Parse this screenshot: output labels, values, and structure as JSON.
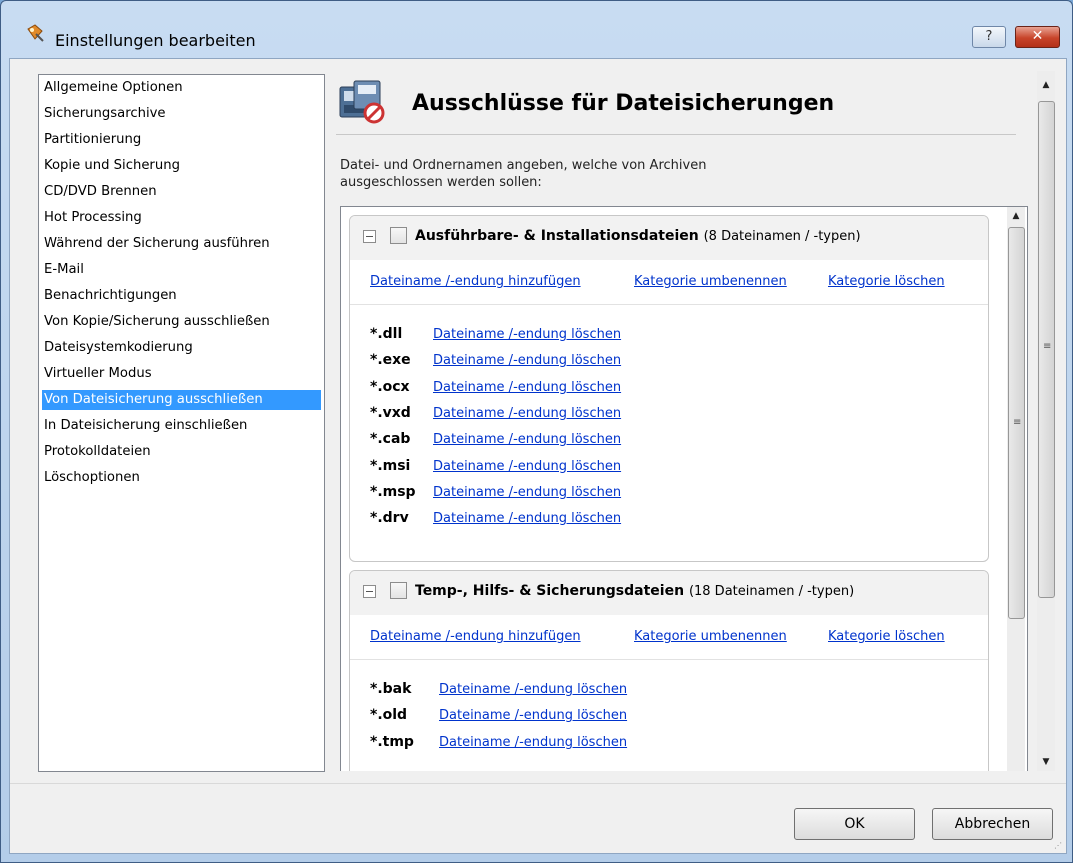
{
  "window": {
    "title": "Einstellungen bearbeiten",
    "help_label": "?",
    "close_label": "✕"
  },
  "nav": {
    "items": [
      "Allgemeine Optionen",
      "Sicherungsarchive",
      "Partitionierung",
      "Kopie und Sicherung",
      "CD/DVD Brennen",
      "Hot Processing",
      "Während der Sicherung ausführen",
      "E-Mail",
      "Benachrichtigungen",
      "Von Kopie/Sicherung ausschließen",
      "Dateisystemkodierung",
      "Virtueller Modus",
      "Von Dateisicherung ausschließen",
      "In Dateisicherung einschließen",
      "Protokolldateien",
      "Löschoptionen"
    ],
    "selected_index": 12
  },
  "content": {
    "title": "Ausschlüsse für Dateisicherungen",
    "description_line1": "Datei- und Ordnernamen angeben, welche von Archiven",
    "description_line2": "ausgeschlossen werden sollen:"
  },
  "categories": [
    {
      "title": "Ausführbare- & Installationsdateien",
      "count": "(8 Dateinamen / -typen)",
      "add_link": "Dateiname /-endung hinzufügen",
      "rename_link": "Kategorie umbenennen",
      "delete_link": "Kategorie löschen",
      "entries": [
        {
          "ext": "*.dll",
          "link": "Dateiname /-endung löschen"
        },
        {
          "ext": "*.exe",
          "link": "Dateiname /-endung löschen"
        },
        {
          "ext": "*.ocx",
          "link": "Dateiname /-endung löschen"
        },
        {
          "ext": "*.vxd",
          "link": "Dateiname /-endung löschen"
        },
        {
          "ext": "*.cab",
          "link": "Dateiname /-endung löschen"
        },
        {
          "ext": "*.msi",
          "link": "Dateiname /-endung löschen"
        },
        {
          "ext": "*.msp",
          "link": "Dateiname /-endung löschen"
        },
        {
          "ext": "*.drv",
          "link": "Dateiname /-endung löschen"
        }
      ]
    },
    {
      "title": "Temp-, Hilfs- & Sicherungsdateien",
      "count": "(18 Dateinamen / -typen)",
      "add_link": "Dateiname /-endung hinzufügen",
      "rename_link": "Kategorie umbenennen",
      "delete_link": "Kategorie löschen",
      "entries": [
        {
          "ext": "*.bak",
          "link": "Dateiname /-endung löschen"
        },
        {
          "ext": "*.old",
          "link": "Dateiname /-endung löschen"
        },
        {
          "ext": "*.tmp",
          "link": "Dateiname /-endung löschen"
        }
      ]
    }
  ],
  "buttons": {
    "ok": "OK",
    "cancel": "Abbrechen"
  },
  "colors": {
    "selection": "#3399ff",
    "link": "#0033cc",
    "close_button": "#c7442a"
  }
}
